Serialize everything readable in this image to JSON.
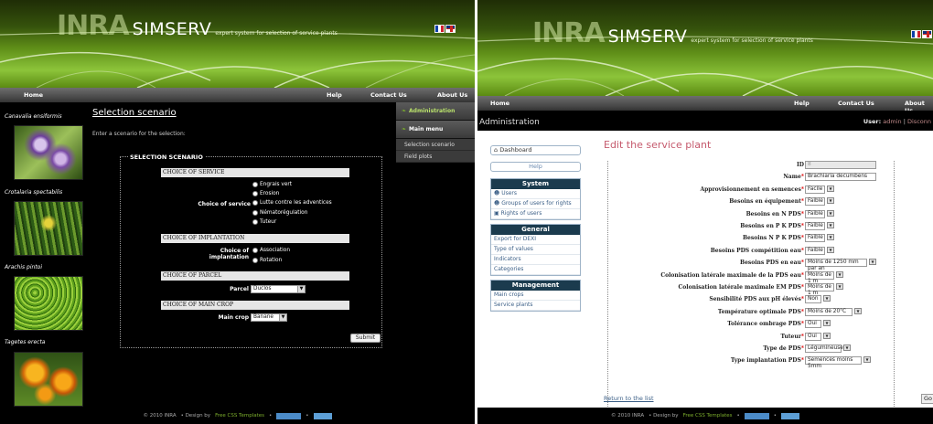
{
  "app": {
    "logo": "INRA",
    "name": "SIMSERV",
    "tagline": "expert system for selection of service plants"
  },
  "nav": {
    "home": "Home",
    "help": "Help",
    "contact": "Contact Us",
    "about": "About Us"
  },
  "footer": {
    "copy": "© 2010 INRA",
    "design": "• Design by",
    "templates": "Free CSS Templates",
    "sep": "•"
  },
  "left_panel": {
    "plants": [
      {
        "name": "Canavalia ensiformis"
      },
      {
        "name": "Crotalaria spectabilis"
      },
      {
        "name": "Arachis pintoi"
      },
      {
        "name": "Tagetes erecta"
      }
    ],
    "page_title": "Selection scenario",
    "intro": "Enter a scenario for the selection:",
    "fieldset": "SELECTION SCENARIO",
    "sections": {
      "service": "CHOICE OF SERVICE",
      "implantation": "CHOICE OF IMPLANTATION",
      "parcel": "CHOICE OF PARCEL",
      "crop": "CHOICE OF MAIN CROP"
    },
    "labels": {
      "service": "Choice of service",
      "implantation_1": "Choice of",
      "implantation_2": "implantation",
      "parcel": "Parcel",
      "crop": "Main crop"
    },
    "service_options": [
      "Engrais vert",
      "Erosion",
      "Lutte contre les adventices",
      "Nématorégulation",
      "Tuteur"
    ],
    "implantation_options": [
      "Association",
      "Rotation"
    ],
    "parcel_value": "Duclos",
    "crop_value": "Banane",
    "submit": "Submit",
    "menu": {
      "administration": "Administration",
      "main_menu": "Main menu",
      "subitems": [
        "Selection scenario",
        "Field plots"
      ]
    }
  },
  "right_panel": {
    "admin_title": "Administration",
    "user_label": "User:",
    "user_name": "admin",
    "user_sep": "|",
    "disconnect": "Disconn",
    "sidebar": {
      "dashboard": "Dashboard",
      "help": "Help",
      "system": {
        "title": "System",
        "links": [
          "Users",
          "Groups of users for rights",
          "Rights of users"
        ]
      },
      "general": {
        "title": "General",
        "links": [
          "Export for DEXI",
          "Type of values",
          "Indicators",
          "Categories"
        ]
      },
      "management": {
        "title": "Management",
        "links": [
          "Main crops",
          "Service plants"
        ]
      }
    },
    "edit_title": "Edit the service plant",
    "fields": [
      {
        "label": "ID",
        "req": "",
        "value": "8",
        "dropdown": false
      },
      {
        "label": "Name",
        "req": "*",
        "value": "Brachiaria decumbens",
        "dropdown": false
      },
      {
        "label": "Approvisionnement en semences",
        "req": "*",
        "value": "Facile",
        "dropdown": true
      },
      {
        "label": "Besoins en équipement",
        "req": "*",
        "value": "Faible",
        "dropdown": true
      },
      {
        "label": "Besoins en N PDS",
        "req": "*",
        "value": "Faible",
        "dropdown": true
      },
      {
        "label": "Besoins en P K PDS",
        "req": "*",
        "value": "Faible",
        "dropdown": true
      },
      {
        "label": "Besoins N P K PDS",
        "req": "*",
        "value": "Faible",
        "dropdown": true
      },
      {
        "label": "Besoins PDS compétition eau",
        "req": "*",
        "value": "Faible",
        "dropdown": true
      },
      {
        "label": "Besoins PDS en eau",
        "req": "*",
        "value": "Moins de 1250 mm par an",
        "dropdown": true
      },
      {
        "label": "Colonisation latérale maximale de la PDS eau",
        "req": "*",
        "value": "Moins de 1 m",
        "dropdown": true
      },
      {
        "label": "Colonisation latérale maximale EM PDS",
        "req": "*",
        "value": "Moins de 1 m",
        "dropdown": true
      },
      {
        "label": "Sensibilité PDS aux pH élevés",
        "req": "*",
        "value": "Non",
        "dropdown": true
      },
      {
        "label": "Température optimale PDS",
        "req": "*",
        "value": "Moins de 20°C",
        "dropdown": true
      },
      {
        "label": "Tolérance ombrage PDS",
        "req": "*",
        "value": "Oui",
        "dropdown": true
      },
      {
        "label": "Tuteur",
        "req": "*",
        "value": "Oui",
        "dropdown": true
      },
      {
        "label": "Type de PDS",
        "req": "*",
        "value": "Légumineuse",
        "dropdown": true
      },
      {
        "label": "Type implantation PDS",
        "req": "*",
        "value": "Semences moins 5mm",
        "dropdown": true
      }
    ],
    "return": "Return to the list",
    "go": "Go"
  },
  "colors": {
    "leaf_green": "#5f8f18",
    "accent_green": "#7cae2c",
    "edit_title": "#c55a6d",
    "sidebar_head": "#1b3b4e",
    "link": "#3a5e86"
  }
}
